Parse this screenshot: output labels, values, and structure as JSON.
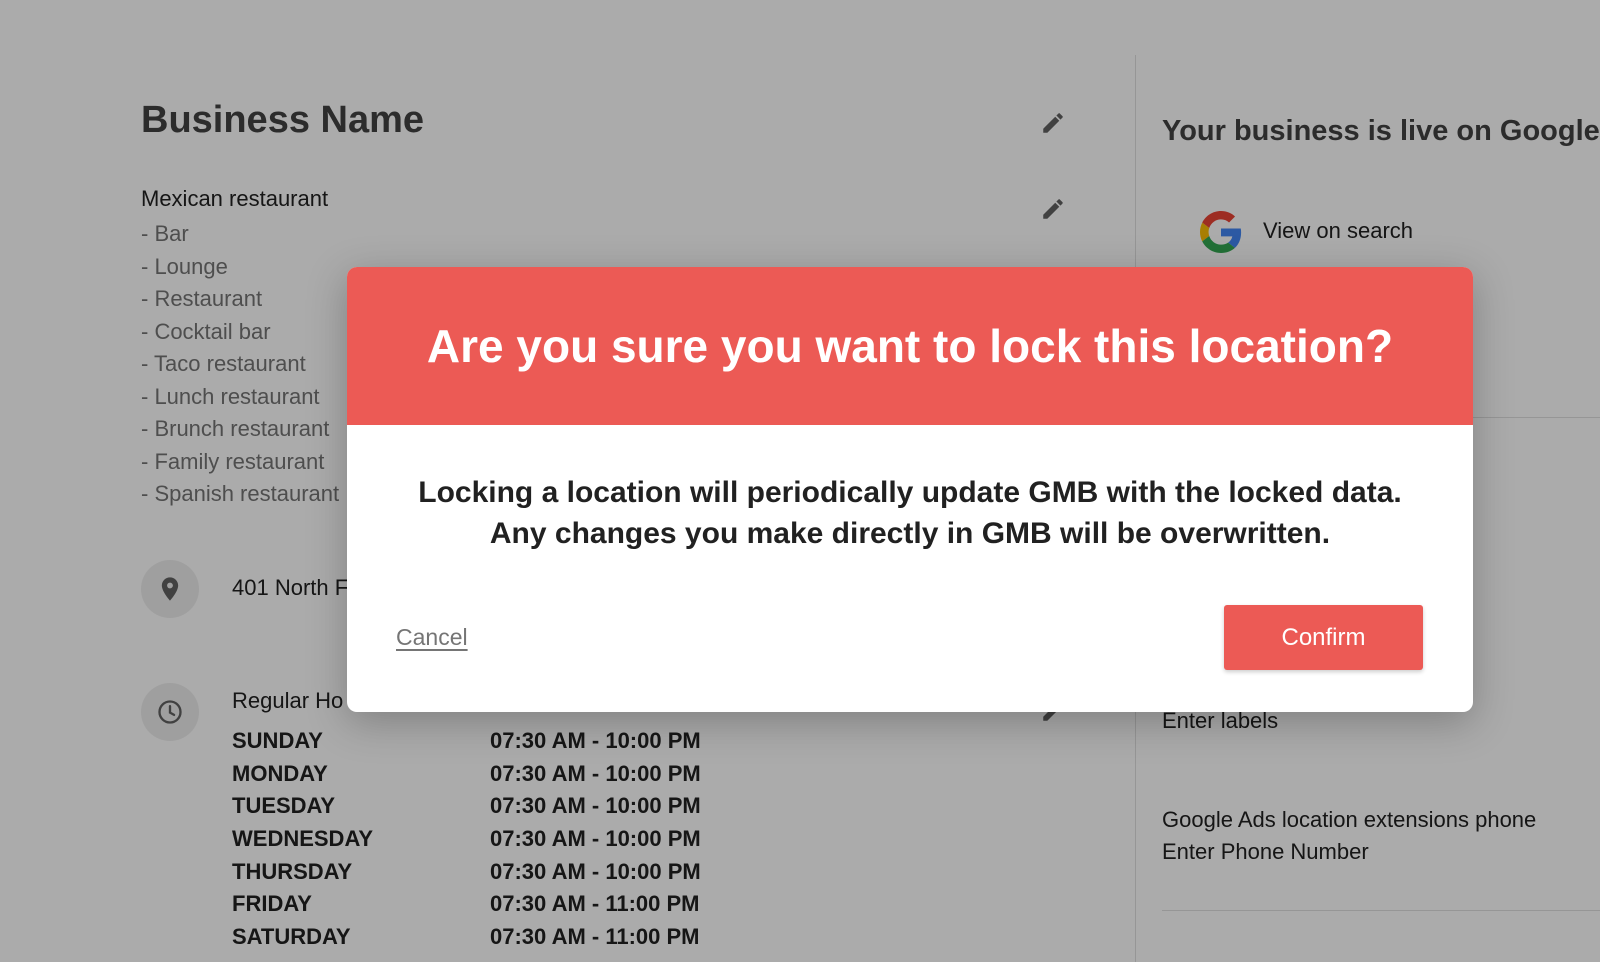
{
  "business": {
    "name": "Business Name",
    "primary_category": "Mexican restaurant",
    "additional_categories": [
      "- Bar",
      "- Lounge",
      "- Restaurant",
      "- Cocktail bar",
      "- Taco restaurant",
      "- Lunch restaurant",
      "- Brunch restaurant",
      "- Family restaurant",
      "- Spanish restaurant"
    ],
    "address": "401 North F",
    "hours_title": "Regular Ho",
    "hours": [
      {
        "day": "SUNDAY",
        "time": "07:30 AM - 10:00 PM"
      },
      {
        "day": "MONDAY",
        "time": "07:30 AM - 10:00 PM"
      },
      {
        "day": "TUESDAY",
        "time": "07:30 AM - 10:00 PM"
      },
      {
        "day": "WEDNESDAY",
        "time": "07:30 AM - 10:00 PM"
      },
      {
        "day": "THURSDAY",
        "time": "07:30 AM - 10:00 PM"
      },
      {
        "day": "FRIDAY",
        "time": "07:30 AM - 11:00 PM"
      },
      {
        "day": "SATURDAY",
        "time": "07:30 AM - 11:00 PM"
      }
    ]
  },
  "sidebar": {
    "live_title": "Your business is live on Google",
    "view_on_search": "View on search",
    "labels_placeholder": "Enter labels",
    "ads_phone_title": "Google Ads location extensions phone",
    "ads_phone_placeholder": "Enter Phone Number"
  },
  "modal": {
    "title": "Are you sure you want to lock this location?",
    "message_line1": "Locking a location will periodically update GMB with the locked data.",
    "message_line2": "Any changes you make directly in GMB will be overwritten.",
    "cancel_label": "Cancel",
    "confirm_label": "Confirm"
  },
  "icons": {
    "edit": "pencil-icon",
    "location": "map-pin-icon",
    "hours": "clock-icon",
    "google": "google-g-icon"
  },
  "colors": {
    "accent": "#ec5a55",
    "overlay": "rgba(0,0,0,0.33)"
  }
}
